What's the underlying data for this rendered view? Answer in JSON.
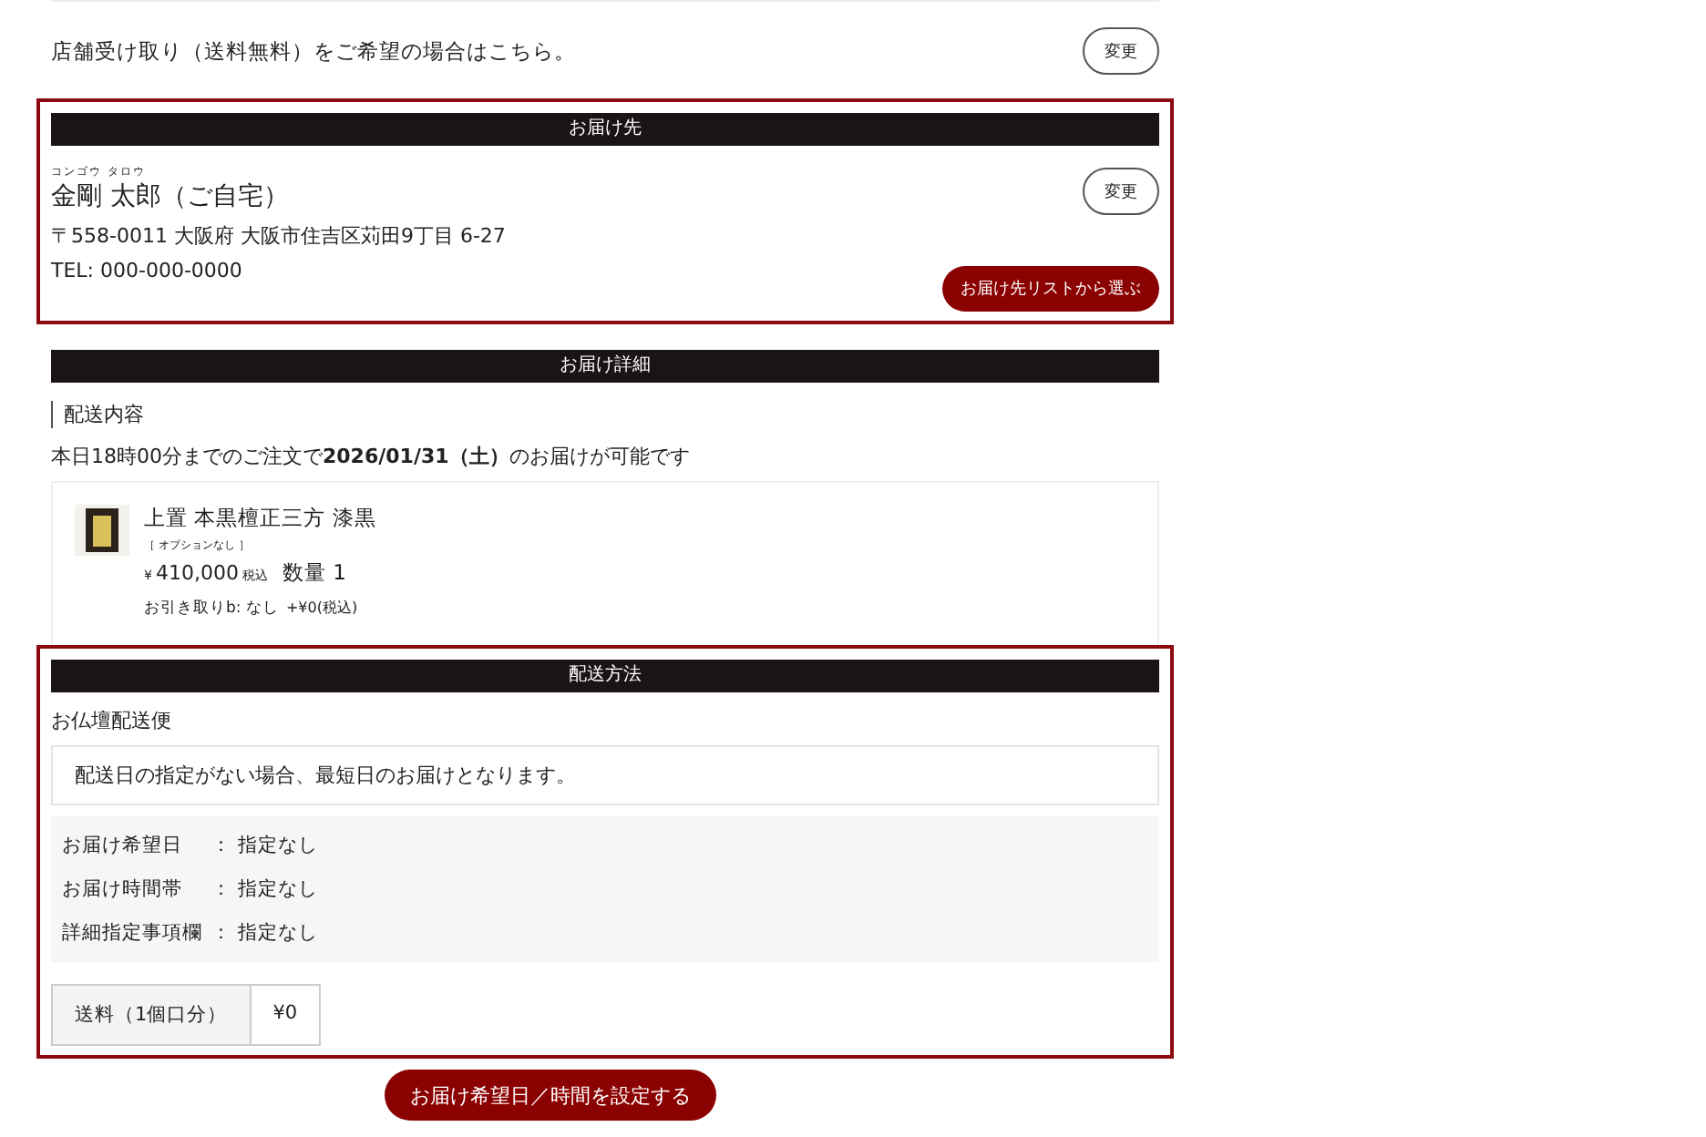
{
  "store_pickup": {
    "text": "店舗受け取り（送料無料）をご希望の場合はこちら。",
    "button": "変更"
  },
  "destination": {
    "heading": "お届け先",
    "furigana": "コンゴウ タロウ",
    "name": "金剛 太郎（ご自宅）",
    "address": "〒558-0011 大阪府 大阪市住吉区苅田9丁目 6-27",
    "phone": "TEL: 000-000-0000",
    "change_button": "変更",
    "list_button": "お届け先リストから選ぶ"
  },
  "details": {
    "heading": "お届け詳細",
    "subheading": "配送内容",
    "notice": "本日18時00分までのご注文で**2026/01/31（土）**のお届けが可能です",
    "item": {
      "name": "上置 本黒檀正三方 漆黒",
      "option": "［ オプションなし ］",
      "currency": "¥",
      "amount": "410,000",
      "tax": "税込",
      "quantity": "数量 1",
      "pickup": "お引き取りb: なし",
      "pickup_price": "+¥0(税込)"
    }
  },
  "shipping": {
    "heading": "配送方法",
    "method": "お仏壇配送便",
    "note": "配送日の指定がない場合、最短日のお届けとなります。",
    "settings": [
      {
        "label": "お届け希望日",
        "value": "： 指定なし"
      },
      {
        "label": "お届け時間帯",
        "value": "： 指定なし"
      },
      {
        "label": "詳細指定事項欄",
        "value": "： 指定なし"
      }
    ],
    "fee_label": "送料（1個口分）",
    "fee_value": "¥0"
  },
  "set_date_button": "お届け希望日／時間を設定する"
}
